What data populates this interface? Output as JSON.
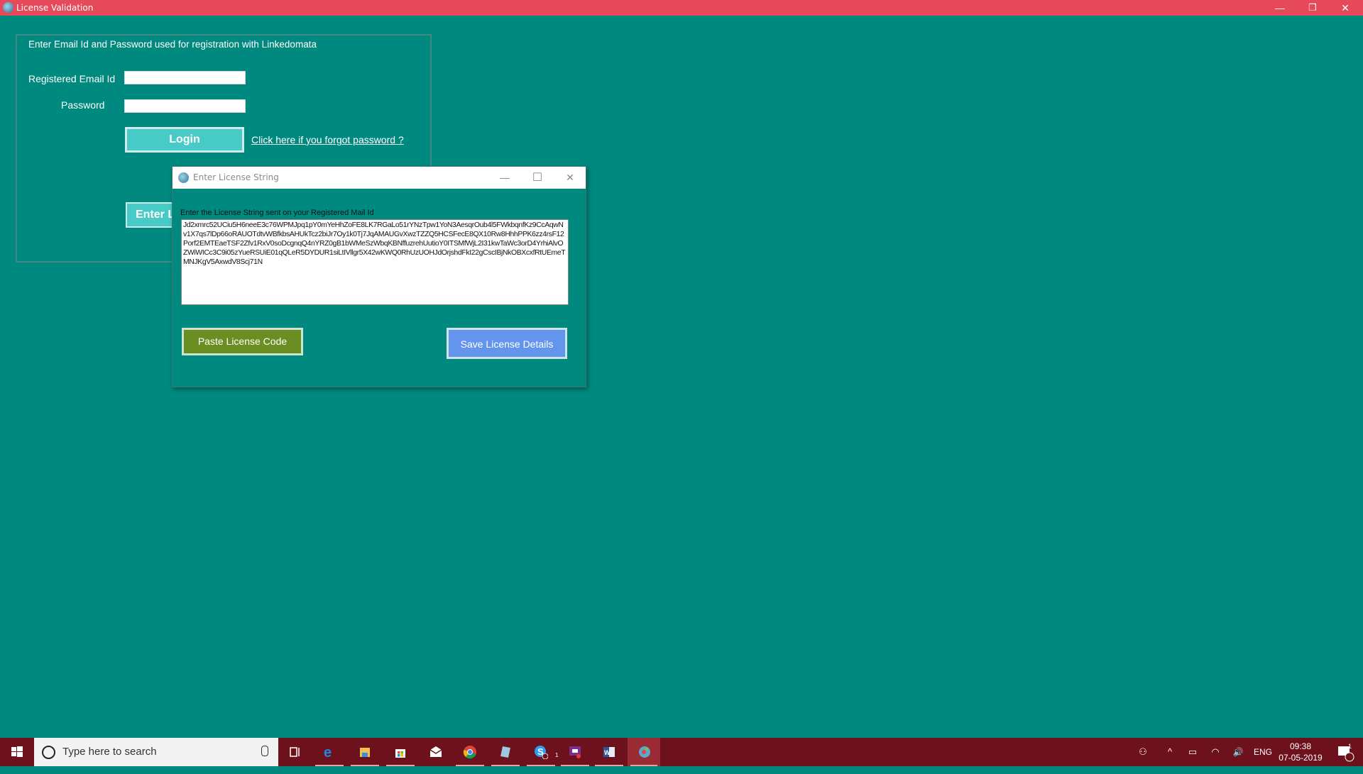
{
  "window": {
    "title": "License Validation",
    "controls": {
      "minimize": "—",
      "restore": "❐",
      "close": "✕"
    }
  },
  "login_panel": {
    "header": "Enter Email Id and Password used for registration with Linkedomata",
    "email_label": "Registered Email Id",
    "email_value": "",
    "password_label": "Password",
    "password_value": "",
    "login_button": "Login",
    "forgot_link": "Click here if you forgot password ?",
    "enter_license_button": "Enter License"
  },
  "dialog": {
    "title": "Enter License String",
    "controls": {
      "minimize": "—",
      "maximize": "☐",
      "close": "✕"
    },
    "prompt": "Enter the License String sent on your Registered Mail Id",
    "license_text": "Jd2xmrc52UCiu5H6neeE3c76WPMJpq1pY0mYeHhZoFE8LK7RGaLo51rYNzTpw1YoN3AesqrOub4l5FWkbqnfKz9CcAqwNv1X7qs7lDp66oRAUOTdtvWBfkbsAHUkTcz2biJr7Oy1k0Tj7JqAMAUGvXwzTZZQ5HCSFecE8QX10Rw8HhhPPK6zz4rsF12Porf2EMTEaeTSF2Zfv1RxV0soDcgnqQ4nYRZ0gB1bWMeSzWbqKBNffuzrehUutioY0ITSMfWjL2I31kwTaWc3orD4YrhiAlvOZWiWICc3C9i05zYueRSUiE01qQLeR5DYDUR1siLtIVllgr5X42wKWQ0RhUzUOHJdOrjshdFkI22gCscIBjNkOBXcxfRtUEmeTMNJKgV5AxwdV8Scj71N",
    "paste_button": "Paste License Code",
    "save_button": "Save License Details"
  },
  "taskbar": {
    "search_placeholder": "Type here to search",
    "apps": [
      {
        "name": "task-view",
        "glyph": "⧉"
      },
      {
        "name": "edge",
        "glyph": "e"
      },
      {
        "name": "file-explorer",
        "glyph": "📁"
      },
      {
        "name": "store",
        "glyph": "🛍"
      },
      {
        "name": "mail",
        "glyph": "✉"
      },
      {
        "name": "chrome",
        "glyph": "◉"
      },
      {
        "name": "notepad",
        "glyph": "▱"
      },
      {
        "name": "skype",
        "glyph": "S",
        "badge": "1"
      },
      {
        "name": "teams-meeting",
        "glyph": "▣"
      },
      {
        "name": "word",
        "glyph": "W"
      },
      {
        "name": "license-app",
        "glyph": "◕"
      }
    ],
    "tray": {
      "people": "⚇",
      "chevron": "^",
      "battery": "▭",
      "wifi": "◠",
      "volume": "🔊",
      "language": "ENG",
      "time": "09:38",
      "date": "07-05-2019",
      "notifications_badge": "1"
    }
  },
  "colors": {
    "titlebar": "#e64a5a",
    "background": "#00897f",
    "login_button": "#48cbc6",
    "paste_button": "#6b8e23",
    "save_button": "#6495ed",
    "taskbar": "#6d111c"
  }
}
